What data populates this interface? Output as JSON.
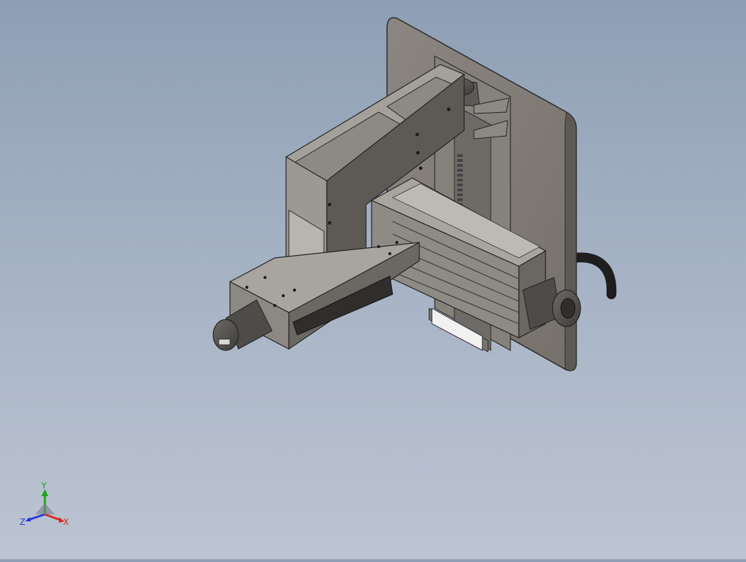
{
  "viewport": {
    "background_top": "#8e9fb5",
    "background_bottom": "#bcc4d2",
    "model": "cad-assembly-gantry-with-two-servo-motors"
  },
  "triad": {
    "x_label": "X",
    "y_label": "Y",
    "z_label": "Z",
    "x_color": "#d92a1e",
    "y_color": "#1ea41e",
    "z_color": "#2a36d9"
  }
}
